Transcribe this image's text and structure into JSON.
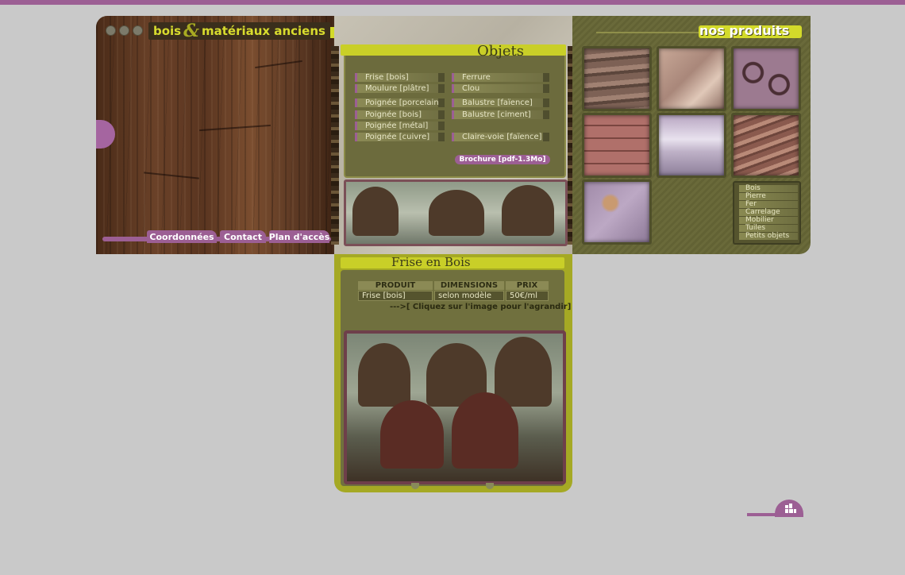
{
  "colors": {
    "accent_purple": "#9c5f94",
    "accent_yellow": "#d3da2a",
    "olive": "#6c6b3d",
    "background": "#c9c9c9"
  },
  "header": {
    "logo_part1": "bois",
    "logo_amp": "&",
    "logo_part2": "matériaux anciens",
    "window_dots": [
      "dot-1",
      "dot-2",
      "dot-3"
    ]
  },
  "nav": {
    "items": [
      "Coordonnées",
      "Contact",
      "Plan d'accès"
    ]
  },
  "objets": {
    "title": "Objets",
    "left_items": [
      "Frise [bois]",
      "Moulure [plâtre]",
      "Poignée [porcelaine]",
      "Poignée [bois]",
      "Poignée [métal]",
      "Poignée [cuivre]"
    ],
    "right_items": [
      "Ferrure",
      "Clou",
      "Balustre [faïence]",
      "Balustre [ciment]",
      "Claire-voie [faïence]"
    ],
    "brochure": "Brochure [pdf-1.3Mo]"
  },
  "produits": {
    "title": "nos produits",
    "categories": [
      "Bois",
      "Pierre",
      "Fer",
      "Carrelage",
      "Mobilier",
      "Tuiles",
      "Petits objets"
    ]
  },
  "detail": {
    "title": "Frise en Bois",
    "columns": [
      "PRODUIT",
      "DIMENSIONS",
      "PRIX"
    ],
    "row": [
      "Frise [bois]",
      "selon modèle",
      "50€/ml"
    ],
    "hint": "--->[ Cliquez sur l'image pour l'agrandir]"
  }
}
